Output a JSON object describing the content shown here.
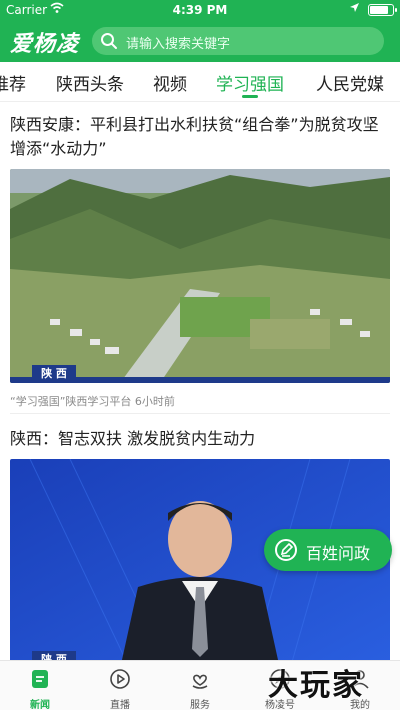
{
  "status": {
    "carrier": "Carrier",
    "time": "4:39 PM"
  },
  "header": {
    "logo": "爱杨凌",
    "search_placeholder": "请输入搜索关键字"
  },
  "tabs": [
    {
      "label": "推荐",
      "active": false
    },
    {
      "label": "陕西头条",
      "active": false
    },
    {
      "label": "视频",
      "active": false
    },
    {
      "label": "学习强国",
      "active": true
    },
    {
      "label": "人民党媒",
      "active": false
    }
  ],
  "articles": [
    {
      "title": "陕西安康：平利县打出水利扶贫“组合拳”为脱贫攻坚增添“水动力”",
      "badge": "陕 西",
      "meta": "“学习强国”陕西学习平台 6小时前"
    },
    {
      "title": "陕西：智志双扶 激发脱贫内生动力",
      "badge": "陕 西"
    }
  ],
  "fab": {
    "label": "百姓问政"
  },
  "bottom_nav": [
    {
      "label": "新闻",
      "icon": "news-icon",
      "active": true
    },
    {
      "label": "直播",
      "icon": "play-icon",
      "active": false
    },
    {
      "label": "服务",
      "icon": "heart-hand-icon",
      "active": false
    },
    {
      "label": "杨凌号",
      "icon": "compass-icon",
      "active": false
    },
    {
      "label": "我的",
      "icon": "user-icon",
      "active": false
    }
  ],
  "watermark": "大玩家",
  "colors": {
    "brand": "#20b354",
    "text": "#222222",
    "meta": "#8a8a8a"
  }
}
